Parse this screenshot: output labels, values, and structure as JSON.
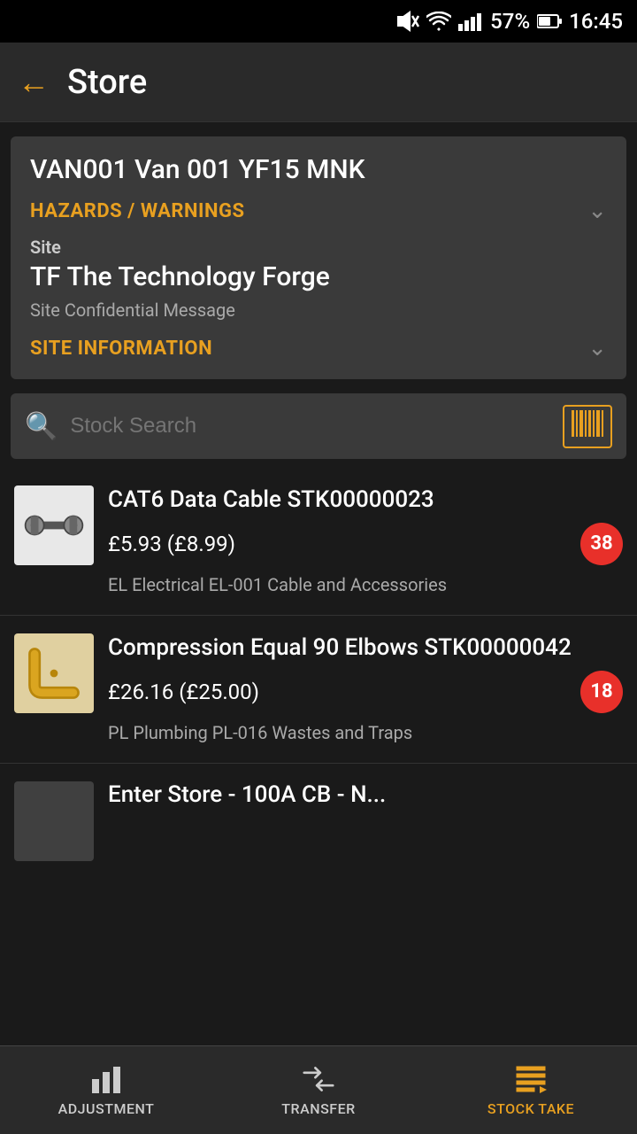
{
  "statusBar": {
    "battery": "57%",
    "time": "16:45",
    "signal": "signal",
    "wifi": "wifi",
    "mute": "mute"
  },
  "header": {
    "backLabel": "←",
    "title": "Store"
  },
  "infoCard": {
    "vanTitle": "VAN001 Van 001 YF15 MNK",
    "hazardsLabel": "HAZARDS / WARNINGS",
    "siteLabel": "Site",
    "siteName": "TF The Technology Forge",
    "siteMessage": "Site Confidential Message",
    "siteInfoLabel": "SITE INFORMATION"
  },
  "search": {
    "placeholder": "Stock Search"
  },
  "stockItems": [
    {
      "id": "item-1",
      "name": "CAT6 Data Cable STK00000023",
      "price": "£5.93 (£8.99)",
      "supplier": "EL Electrical EL-001 Cable and Accessories",
      "badge": "38",
      "type": "cable"
    },
    {
      "id": "item-2",
      "name": "Compression Equal 90 Elbows STK00000042",
      "price": "£26.16 (£25.00)",
      "supplier": "PL Plumbing PL-016 Wastes and Traps",
      "badge": "18",
      "type": "elbow"
    }
  ],
  "partialItem": {
    "namePartial": "Enter Store - 100A CB - N..."
  },
  "bottomNav": [
    {
      "id": "adjustment",
      "label": "ADJUSTMENT",
      "icon": "chart-bar",
      "active": false
    },
    {
      "id": "transfer",
      "label": "TRANSFER",
      "icon": "transfer-arrows",
      "active": false
    },
    {
      "id": "stocktake",
      "label": "STOCK TAKE",
      "icon": "list-bars",
      "active": false
    }
  ]
}
